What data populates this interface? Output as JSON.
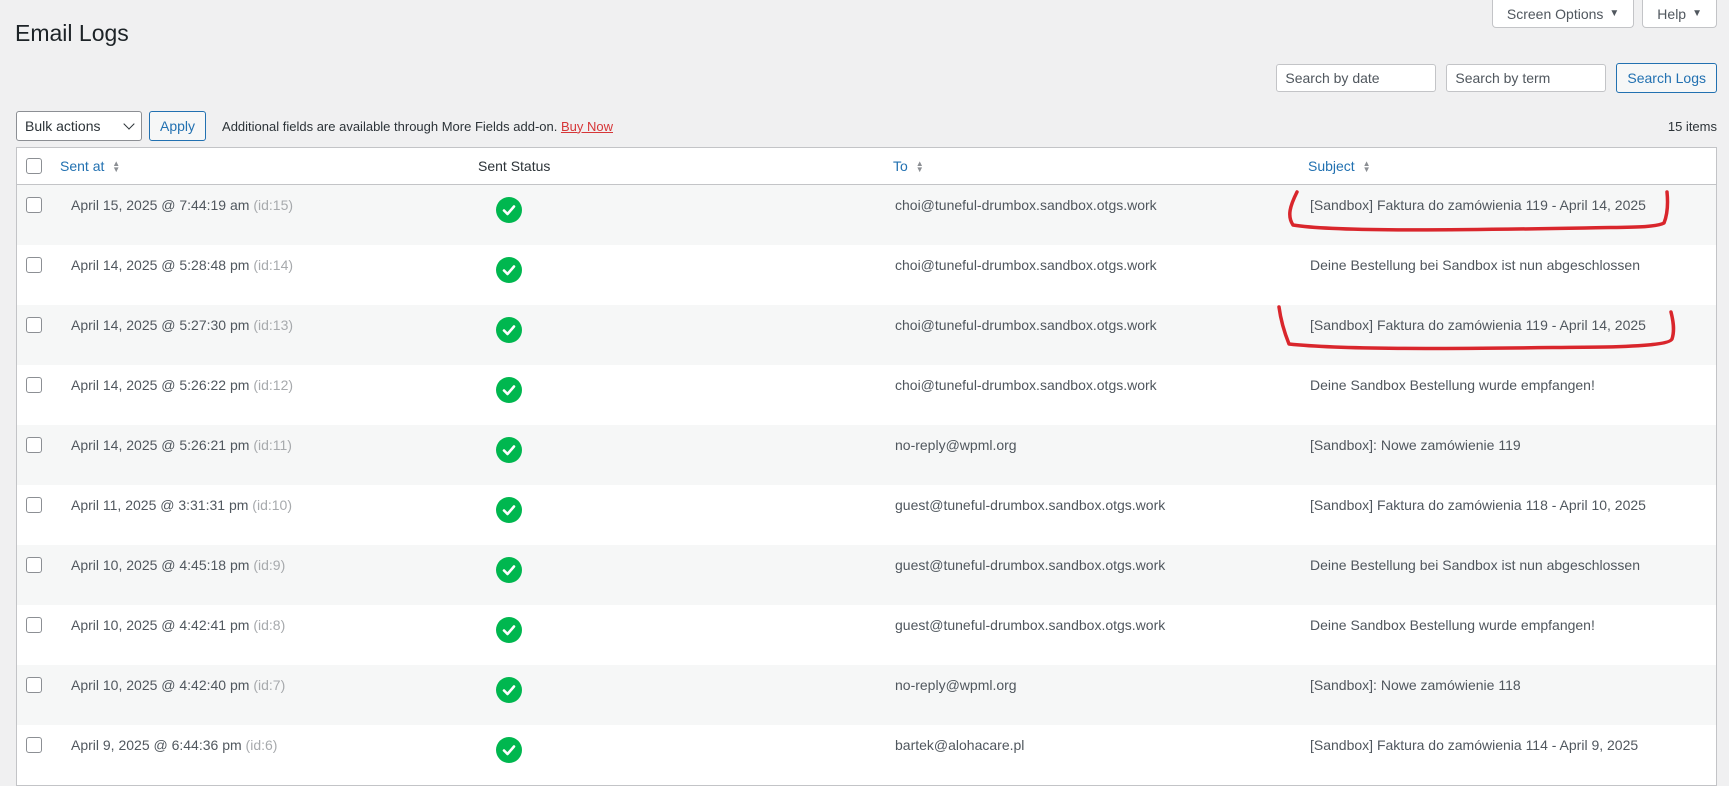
{
  "header": {
    "title": "Email Logs",
    "screen_options_label": "Screen Options",
    "help_label": "Help"
  },
  "search": {
    "date_placeholder": "Search by date",
    "term_placeholder": "Search by term",
    "button_label": "Search Logs"
  },
  "tablenav": {
    "bulk_actions_label": "Bulk actions",
    "apply_label": "Apply",
    "notice_text": "Additional fields are available through More Fields add-on.",
    "buy_now_label": "Buy Now",
    "items_count": "15 items"
  },
  "table": {
    "columns": {
      "sent_at": "Sent at",
      "sent_status": "Sent Status",
      "to": "To",
      "subject": "Subject"
    },
    "rows": [
      {
        "sent_at": "April 15, 2025 @ 7:44:19 am",
        "id": "(id:15)",
        "status": "success-check-icon",
        "to": "choi@tuneful-drumbox.sandbox.otgs.work",
        "subject": "[Sandbox] Faktura do zamówienia 119 - April 14, 2025"
      },
      {
        "sent_at": "April 14, 2025 @ 5:28:48 pm",
        "id": "(id:14)",
        "status": "success-check-icon",
        "to": "choi@tuneful-drumbox.sandbox.otgs.work",
        "subject": "Deine Bestellung bei Sandbox ist nun abgeschlossen"
      },
      {
        "sent_at": "April 14, 2025 @ 5:27:30 pm",
        "id": "(id:13)",
        "status": "success-check-icon",
        "to": "choi@tuneful-drumbox.sandbox.otgs.work",
        "subject": "[Sandbox] Faktura do zamówienia 119 - April 14, 2025"
      },
      {
        "sent_at": "April 14, 2025 @ 5:26:22 pm",
        "id": "(id:12)",
        "status": "success-check-icon",
        "to": "choi@tuneful-drumbox.sandbox.otgs.work",
        "subject": "Deine Sandbox Bestellung wurde empfangen!"
      },
      {
        "sent_at": "April 14, 2025 @ 5:26:21 pm",
        "id": "(id:11)",
        "status": "success-check-icon",
        "to": "no-reply@wpml.org",
        "subject": "[Sandbox]: Nowe zamówienie 119"
      },
      {
        "sent_at": "April 11, 2025 @ 3:31:31 pm",
        "id": "(id:10)",
        "status": "success-check-icon",
        "to": "guest@tuneful-drumbox.sandbox.otgs.work",
        "subject": "[Sandbox] Faktura do zamówienia 118 - April 10, 2025"
      },
      {
        "sent_at": "April 10, 2025 @ 4:45:18 pm",
        "id": "(id:9)",
        "status": "success-check-icon",
        "to": "guest@tuneful-drumbox.sandbox.otgs.work",
        "subject": "Deine Bestellung bei Sandbox ist nun abgeschlossen"
      },
      {
        "sent_at": "April 10, 2025 @ 4:42:41 pm",
        "id": "(id:8)",
        "status": "success-check-icon",
        "to": "guest@tuneful-drumbox.sandbox.otgs.work",
        "subject": "Deine Sandbox Bestellung wurde empfangen!"
      },
      {
        "sent_at": "April 10, 2025 @ 4:42:40 pm",
        "id": "(id:7)",
        "status": "success-check-icon",
        "to": "no-reply@wpml.org",
        "subject": "[Sandbox]: Nowe zamówienie 118"
      },
      {
        "sent_at": "April 9, 2025 @ 6:44:36 pm",
        "id": "(id:6)",
        "status": "success-check-icon",
        "to": "bartek@alohacare.pl",
        "subject": "[Sandbox] Faktura do zamówienia 114 - April 9, 2025"
      }
    ]
  },
  "colors": {
    "accent": "#2271b1",
    "success": "#00b74f",
    "annotation": "#d9262c",
    "buy_now": "#d63638"
  }
}
